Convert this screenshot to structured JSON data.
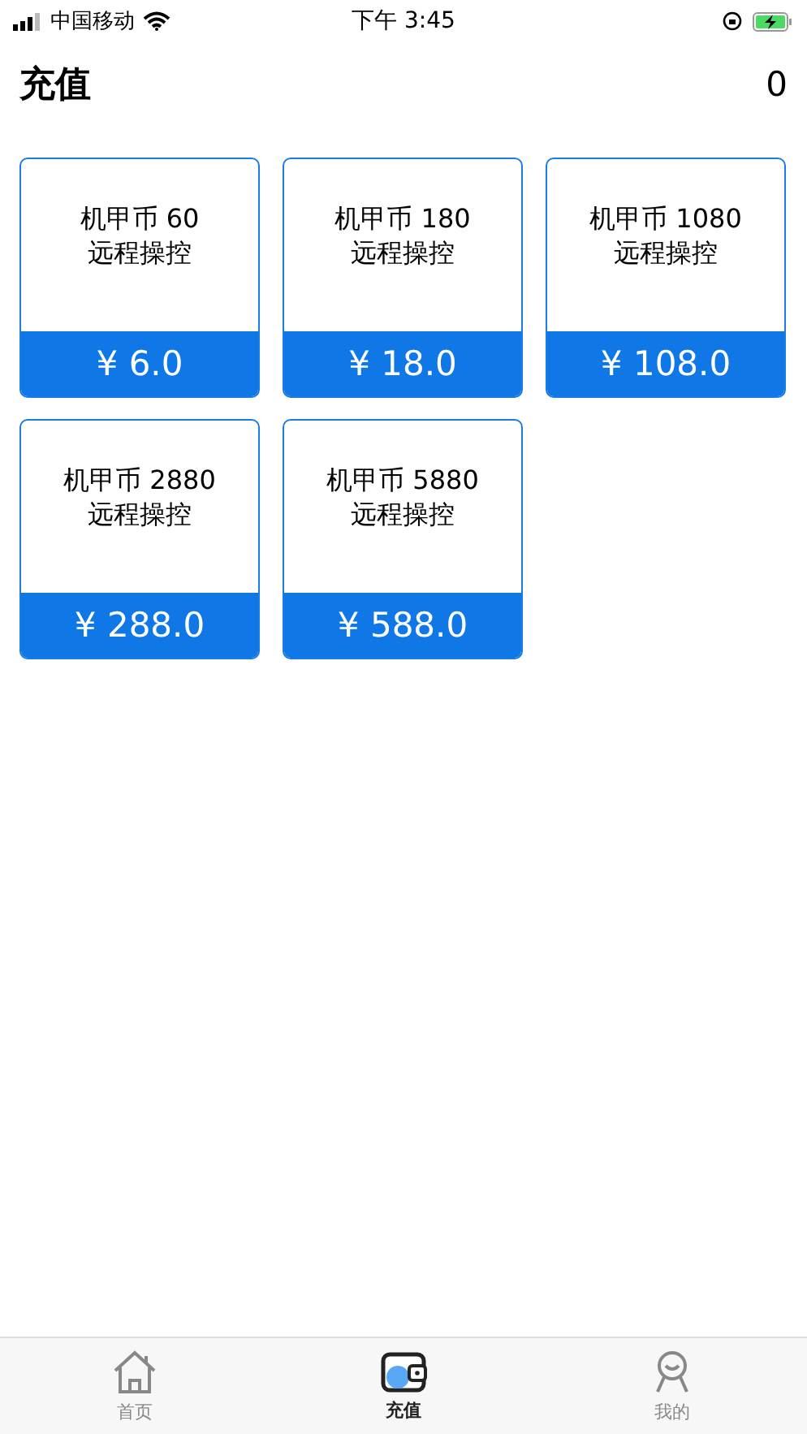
{
  "status_bar": {
    "carrier": "中国移动",
    "time": "下午 3:45",
    "charging": true
  },
  "header": {
    "title": "充值",
    "balance": "0"
  },
  "products": [
    {
      "name": "机甲币 60",
      "desc": "远程操控",
      "price": "¥ 6.0"
    },
    {
      "name": "机甲币 180",
      "desc": "远程操控",
      "price": "¥ 18.0"
    },
    {
      "name": "机甲币 1080",
      "desc": "远程操控",
      "price": "¥ 108.0"
    },
    {
      "name": "机甲币 2880",
      "desc": "远程操控",
      "price": "¥ 288.0"
    },
    {
      "name": "机甲币 5880",
      "desc": "远程操控",
      "price": "¥ 588.0"
    }
  ],
  "tab_bar": [
    {
      "label": "首页",
      "kind": "home",
      "selected": false
    },
    {
      "label": "充值",
      "kind": "wallet",
      "selected": true
    },
    {
      "label": "我的",
      "kind": "profile",
      "selected": false
    }
  ]
}
